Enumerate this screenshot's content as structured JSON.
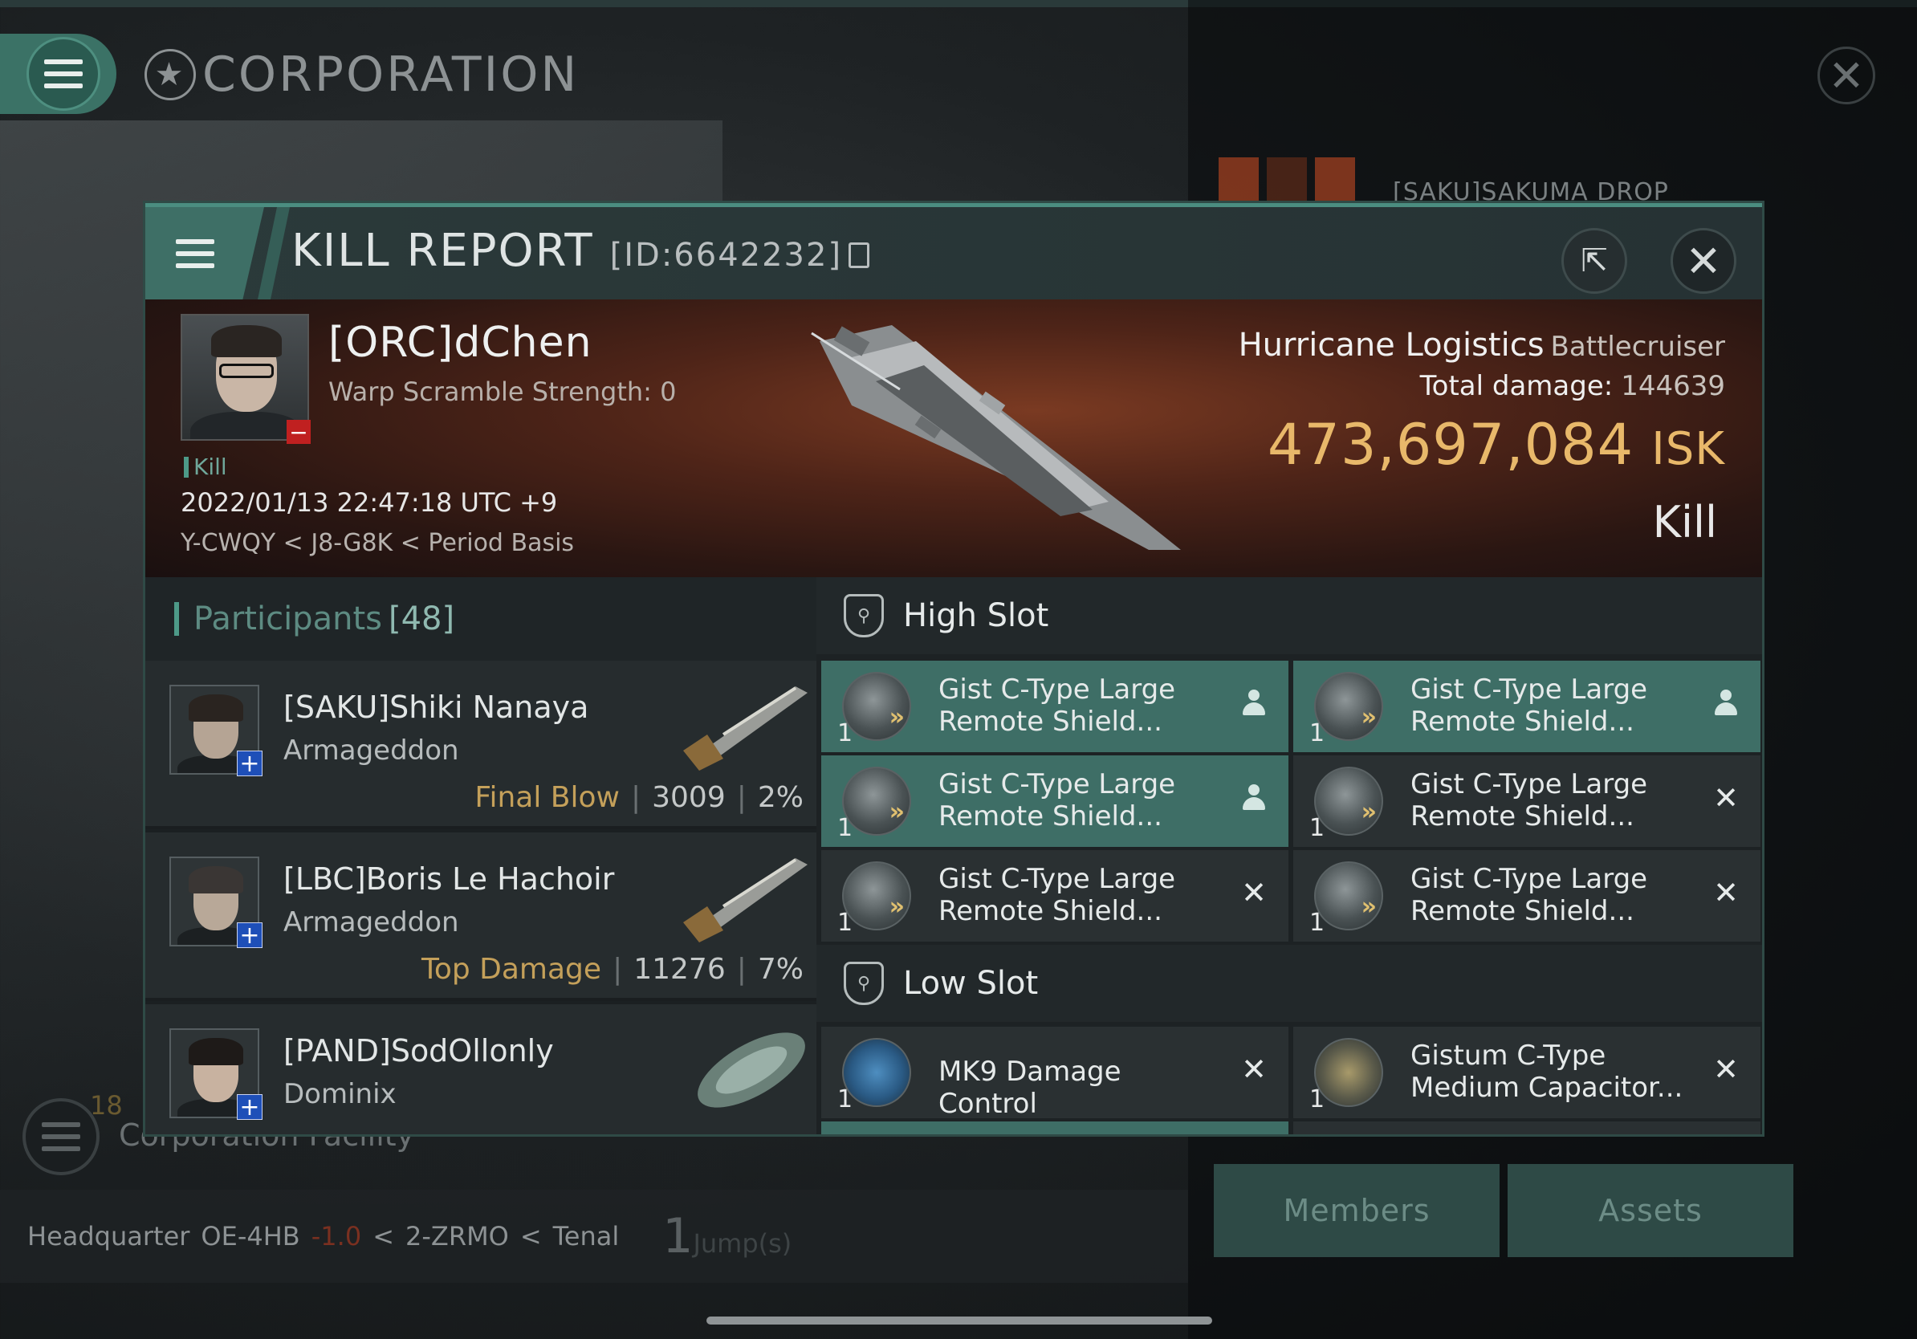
{
  "background": {
    "title": "CORPORATION",
    "corp_name_partial": "[SAKU]SAKUMA DROP",
    "corp_facility_count": "18",
    "corp_facility_label": "Corporation Facility",
    "hq_label": "Headquarter",
    "hq_system": "OE-4HB",
    "hq_security": "-1.0",
    "hq_constellation": "2-ZRMO",
    "hq_region": "Tenal",
    "jumps_value": "1",
    "jumps_label": "Jump(s)",
    "members_button": "Members",
    "assets_button": "Assets"
  },
  "modal": {
    "title": "KILL REPORT",
    "report_id": "[ID:6642232]",
    "victim": {
      "name": "[ORC]dChen",
      "warp_scramble": "Warp Scramble Strength: 0",
      "tag": "Kill",
      "datetime": "2022/01/13 22:47:18 UTC +9",
      "location": "Y-CWQY < J8-G8K < Period Basis"
    },
    "ship": {
      "name": "Hurricane Logistics",
      "class": "Battlecruiser",
      "total_damage_label": "Total damage:",
      "total_damage_value": "144639",
      "isk_value": "473,697,084",
      "isk_unit": "ISK",
      "kill_type": "Kill"
    },
    "participants": {
      "label": "Participants",
      "count": "[48]",
      "rows": [
        {
          "name": "[SAKU]Shiki Nanaya",
          "ship": "Armageddon",
          "role": "Final Blow",
          "damage": "3009",
          "percent": "2%"
        },
        {
          "name": "[LBC]Boris Le Hachoir",
          "ship": "Armageddon",
          "role": "Top Damage",
          "damage": "11276",
          "percent": "7%"
        },
        {
          "name": "[PAND]SodOllonly",
          "ship": "Dominix",
          "role": "",
          "damage": "",
          "percent": ""
        }
      ]
    },
    "high_slot": {
      "label": "High Slot",
      "modules": [
        {
          "qty": "1",
          "name_line1": "Gist C-Type Large",
          "name_line2": "Remote Shield...",
          "status": "pilot-icon"
        },
        {
          "qty": "1",
          "name_line1": "Gist C-Type Large",
          "name_line2": "Remote Shield...",
          "status": "pilot-icon"
        },
        {
          "qty": "1",
          "name_line1": "Gist C-Type Large",
          "name_line2": "Remote Shield...",
          "status": "pilot-icon"
        },
        {
          "qty": "1",
          "name_line1": "Gist C-Type Large",
          "name_line2": "Remote Shield...",
          "status": "destroyed-icon"
        },
        {
          "qty": "1",
          "name_line1": "Gist C-Type Large",
          "name_line2": "Remote Shield...",
          "status": "destroyed-icon"
        },
        {
          "qty": "1",
          "name_line1": "Gist C-Type Large",
          "name_line2": "Remote Shield...",
          "status": "destroyed-icon"
        }
      ]
    },
    "low_slot": {
      "label": "Low Slot",
      "modules": [
        {
          "qty": "1",
          "name": "MK9 Damage Control",
          "status": "destroyed-icon"
        },
        {
          "qty": "1",
          "name_line1": "Gistum C-Type",
          "name_line2": "Medium Capacitor...",
          "status": "destroyed-icon"
        }
      ]
    }
  },
  "colors": {
    "accent": "#4d9a88",
    "isk": "#e8b86a",
    "role_label": "#c4a05a",
    "dropped_row": "#3e6e66"
  }
}
